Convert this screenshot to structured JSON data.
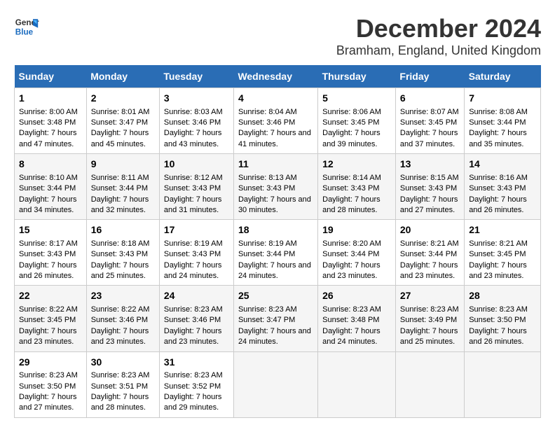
{
  "logo": {
    "line1": "General",
    "line2": "Blue"
  },
  "title": "December 2024",
  "subtitle": "Bramham, England, United Kingdom",
  "days_header": [
    "Sunday",
    "Monday",
    "Tuesday",
    "Wednesday",
    "Thursday",
    "Friday",
    "Saturday"
  ],
  "weeks": [
    [
      {
        "day": "1",
        "sunrise": "Sunrise: 8:00 AM",
        "sunset": "Sunset: 3:48 PM",
        "daylight": "Daylight: 7 hours and 47 minutes."
      },
      {
        "day": "2",
        "sunrise": "Sunrise: 8:01 AM",
        "sunset": "Sunset: 3:47 PM",
        "daylight": "Daylight: 7 hours and 45 minutes."
      },
      {
        "day": "3",
        "sunrise": "Sunrise: 8:03 AM",
        "sunset": "Sunset: 3:46 PM",
        "daylight": "Daylight: 7 hours and 43 minutes."
      },
      {
        "day": "4",
        "sunrise": "Sunrise: 8:04 AM",
        "sunset": "Sunset: 3:46 PM",
        "daylight": "Daylight: 7 hours and 41 minutes."
      },
      {
        "day": "5",
        "sunrise": "Sunrise: 8:06 AM",
        "sunset": "Sunset: 3:45 PM",
        "daylight": "Daylight: 7 hours and 39 minutes."
      },
      {
        "day": "6",
        "sunrise": "Sunrise: 8:07 AM",
        "sunset": "Sunset: 3:45 PM",
        "daylight": "Daylight: 7 hours and 37 minutes."
      },
      {
        "day": "7",
        "sunrise": "Sunrise: 8:08 AM",
        "sunset": "Sunset: 3:44 PM",
        "daylight": "Daylight: 7 hours and 35 minutes."
      }
    ],
    [
      {
        "day": "8",
        "sunrise": "Sunrise: 8:10 AM",
        "sunset": "Sunset: 3:44 PM",
        "daylight": "Daylight: 7 hours and 34 minutes."
      },
      {
        "day": "9",
        "sunrise": "Sunrise: 8:11 AM",
        "sunset": "Sunset: 3:44 PM",
        "daylight": "Daylight: 7 hours and 32 minutes."
      },
      {
        "day": "10",
        "sunrise": "Sunrise: 8:12 AM",
        "sunset": "Sunset: 3:43 PM",
        "daylight": "Daylight: 7 hours and 31 minutes."
      },
      {
        "day": "11",
        "sunrise": "Sunrise: 8:13 AM",
        "sunset": "Sunset: 3:43 PM",
        "daylight": "Daylight: 7 hours and 30 minutes."
      },
      {
        "day": "12",
        "sunrise": "Sunrise: 8:14 AM",
        "sunset": "Sunset: 3:43 PM",
        "daylight": "Daylight: 7 hours and 28 minutes."
      },
      {
        "day": "13",
        "sunrise": "Sunrise: 8:15 AM",
        "sunset": "Sunset: 3:43 PM",
        "daylight": "Daylight: 7 hours and 27 minutes."
      },
      {
        "day": "14",
        "sunrise": "Sunrise: 8:16 AM",
        "sunset": "Sunset: 3:43 PM",
        "daylight": "Daylight: 7 hours and 26 minutes."
      }
    ],
    [
      {
        "day": "15",
        "sunrise": "Sunrise: 8:17 AM",
        "sunset": "Sunset: 3:43 PM",
        "daylight": "Daylight: 7 hours and 26 minutes."
      },
      {
        "day": "16",
        "sunrise": "Sunrise: 8:18 AM",
        "sunset": "Sunset: 3:43 PM",
        "daylight": "Daylight: 7 hours and 25 minutes."
      },
      {
        "day": "17",
        "sunrise": "Sunrise: 8:19 AM",
        "sunset": "Sunset: 3:43 PM",
        "daylight": "Daylight: 7 hours and 24 minutes."
      },
      {
        "day": "18",
        "sunrise": "Sunrise: 8:19 AM",
        "sunset": "Sunset: 3:44 PM",
        "daylight": "Daylight: 7 hours and 24 minutes."
      },
      {
        "day": "19",
        "sunrise": "Sunrise: 8:20 AM",
        "sunset": "Sunset: 3:44 PM",
        "daylight": "Daylight: 7 hours and 23 minutes."
      },
      {
        "day": "20",
        "sunrise": "Sunrise: 8:21 AM",
        "sunset": "Sunset: 3:44 PM",
        "daylight": "Daylight: 7 hours and 23 minutes."
      },
      {
        "day": "21",
        "sunrise": "Sunrise: 8:21 AM",
        "sunset": "Sunset: 3:45 PM",
        "daylight": "Daylight: 7 hours and 23 minutes."
      }
    ],
    [
      {
        "day": "22",
        "sunrise": "Sunrise: 8:22 AM",
        "sunset": "Sunset: 3:45 PM",
        "daylight": "Daylight: 7 hours and 23 minutes."
      },
      {
        "day": "23",
        "sunrise": "Sunrise: 8:22 AM",
        "sunset": "Sunset: 3:46 PM",
        "daylight": "Daylight: 7 hours and 23 minutes."
      },
      {
        "day": "24",
        "sunrise": "Sunrise: 8:23 AM",
        "sunset": "Sunset: 3:46 PM",
        "daylight": "Daylight: 7 hours and 23 minutes."
      },
      {
        "day": "25",
        "sunrise": "Sunrise: 8:23 AM",
        "sunset": "Sunset: 3:47 PM",
        "daylight": "Daylight: 7 hours and 24 minutes."
      },
      {
        "day": "26",
        "sunrise": "Sunrise: 8:23 AM",
        "sunset": "Sunset: 3:48 PM",
        "daylight": "Daylight: 7 hours and 24 minutes."
      },
      {
        "day": "27",
        "sunrise": "Sunrise: 8:23 AM",
        "sunset": "Sunset: 3:49 PM",
        "daylight": "Daylight: 7 hours and 25 minutes."
      },
      {
        "day": "28",
        "sunrise": "Sunrise: 8:23 AM",
        "sunset": "Sunset: 3:50 PM",
        "daylight": "Daylight: 7 hours and 26 minutes."
      }
    ],
    [
      {
        "day": "29",
        "sunrise": "Sunrise: 8:23 AM",
        "sunset": "Sunset: 3:50 PM",
        "daylight": "Daylight: 7 hours and 27 minutes."
      },
      {
        "day": "30",
        "sunrise": "Sunrise: 8:23 AM",
        "sunset": "Sunset: 3:51 PM",
        "daylight": "Daylight: 7 hours and 28 minutes."
      },
      {
        "day": "31",
        "sunrise": "Sunrise: 8:23 AM",
        "sunset": "Sunset: 3:52 PM",
        "daylight": "Daylight: 7 hours and 29 minutes."
      },
      null,
      null,
      null,
      null
    ]
  ]
}
